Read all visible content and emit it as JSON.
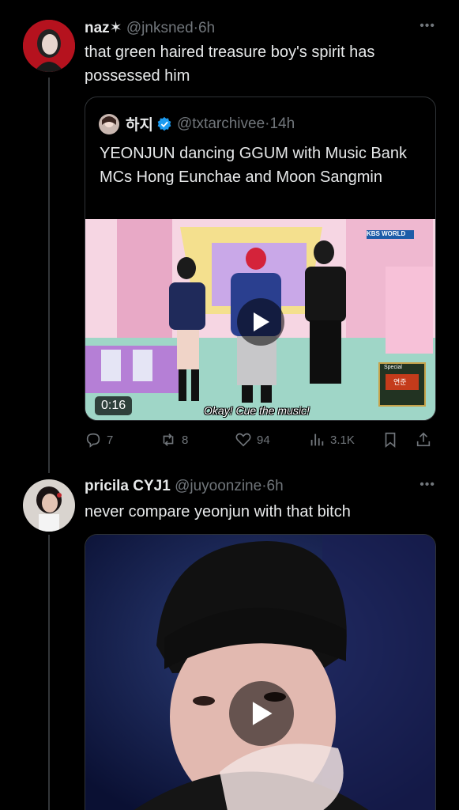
{
  "tweet1": {
    "name": "naz✶",
    "handle": "@jnksned",
    "time": "6h",
    "text": "that green haired treasure boy's spirit has possessed him",
    "quote": {
      "name": "하지",
      "handle": "@txtarchivee",
      "time": "14h",
      "text": "YEONJUN dancing GGUM with Music Bank MCs Hong Eunchae and Moon Sangmin",
      "video": {
        "duration": "0:16",
        "subtitle": "Okay! Cue the music!",
        "watermark": "KBS WORLD",
        "badge": "Special",
        "badge_name": "연준"
      }
    },
    "actions": {
      "replies": "7",
      "reposts": "8",
      "likes": "94",
      "views": "3.1K"
    }
  },
  "tweet2": {
    "name": "pricila CYJ1",
    "handle": "@juyoonzine",
    "time": "6h",
    "text": "never compare yeonjun with that bitch"
  },
  "icons": [
    "more-icon",
    "verified-icon",
    "play-icon",
    "reply-icon",
    "repost-icon",
    "like-icon",
    "views-icon",
    "bookmark-icon",
    "share-icon"
  ],
  "colors": {
    "background": "#000000",
    "text": "#e7e9ea",
    "muted": "#71767b",
    "verified": "#1d9bf0",
    "border": "#2f3336"
  }
}
